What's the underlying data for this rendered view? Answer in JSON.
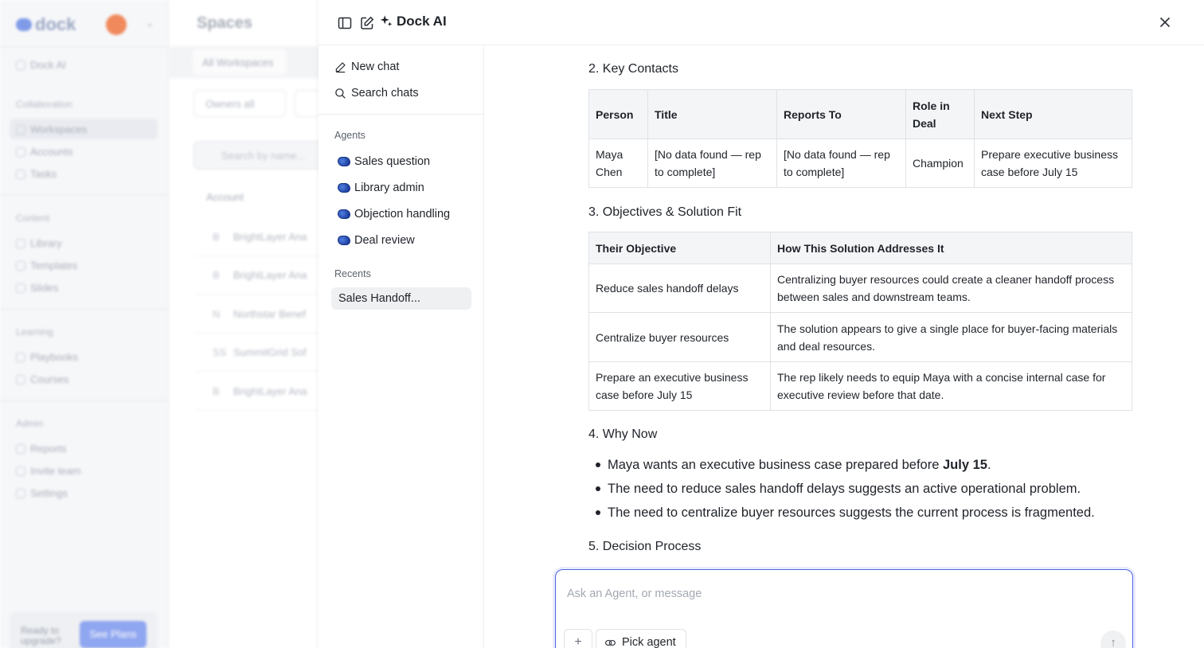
{
  "background": {
    "logo": "dock",
    "nav_top": "Dock AI",
    "sections": [
      {
        "title": "Collaboration",
        "items": [
          "Workspaces",
          "Accounts",
          "Tasks"
        ]
      },
      {
        "title": "Content",
        "items": [
          "Library",
          "Templates",
          "Slides"
        ]
      },
      {
        "title": "Learning",
        "items": [
          "Playbooks",
          "Courses"
        ]
      },
      {
        "title": "Admin",
        "items": [
          "Reports",
          "Invite team",
          "Settings"
        ]
      }
    ],
    "upgrade_text": "Ready to upgrade?",
    "upgrade_button": "See Plans",
    "page_title": "Spaces",
    "tab": "All Workspaces",
    "filter_owners": "Owners all",
    "search_placeholder": "Search by name...",
    "column_account": "Account",
    "rows": [
      {
        "initial": "B",
        "name": "BrightLayer Ana"
      },
      {
        "initial": "B",
        "name": "BrightLayer Ana"
      },
      {
        "initial": "N",
        "name": "Northstar Benef"
      },
      {
        "initial": "SS",
        "name": "SummitGrid Sof"
      },
      {
        "initial": "B",
        "name": "BrightLayer Ana"
      }
    ]
  },
  "panel": {
    "title": "Dock AI",
    "sidebar": {
      "new_chat": "New chat",
      "search_chats": "Search chats",
      "agents_label": "Agents",
      "agents": [
        "Sales question",
        "Library admin",
        "Objection handling",
        "Deal review"
      ],
      "recents_label": "Recents",
      "recents": [
        "Sales Handoff..."
      ]
    },
    "content": {
      "section2_title": "2. Key Contacts",
      "contacts_headers": [
        "Person",
        "Title",
        "Reports To",
        "Role in Deal",
        "Next Step"
      ],
      "contacts_rows": [
        [
          "Maya Chen",
          "[No data found — rep to complete]",
          "[No data found — rep to complete]",
          "Champion",
          "Prepare executive business case before July 15"
        ]
      ],
      "section3_title": "3. Objectives & Solution Fit",
      "objectives_headers": [
        "Their Objective",
        "How This Solution Addresses It"
      ],
      "objectives_rows": [
        [
          "Reduce sales handoff delays",
          "Centralizing buyer resources could create a cleaner handoff process between sales and downstream teams."
        ],
        [
          "Centralize buyer resources",
          "The solution appears to give a single place for buyer-facing materials and deal resources."
        ],
        [
          "Prepare an executive business case before July 15",
          "The rep likely needs to equip Maya with a concise internal case for executive review before that date."
        ]
      ],
      "section4_title": "4. Why Now",
      "why_now_1_prefix": "Maya wants an executive business case prepared before ",
      "why_now_1_bold": "July 15",
      "why_now_1_suffix": ".",
      "why_now_2": "The need to reduce sales handoff delays suggests an active operational problem.",
      "why_now_3": "The need to centralize buyer resources suggests the current process is fragmented.",
      "section5_title": "5. Decision Process"
    },
    "composer": {
      "placeholder": "Ask an Agent, or message",
      "plus": "+",
      "pick_agent": "Pick agent",
      "send": "↑"
    }
  }
}
